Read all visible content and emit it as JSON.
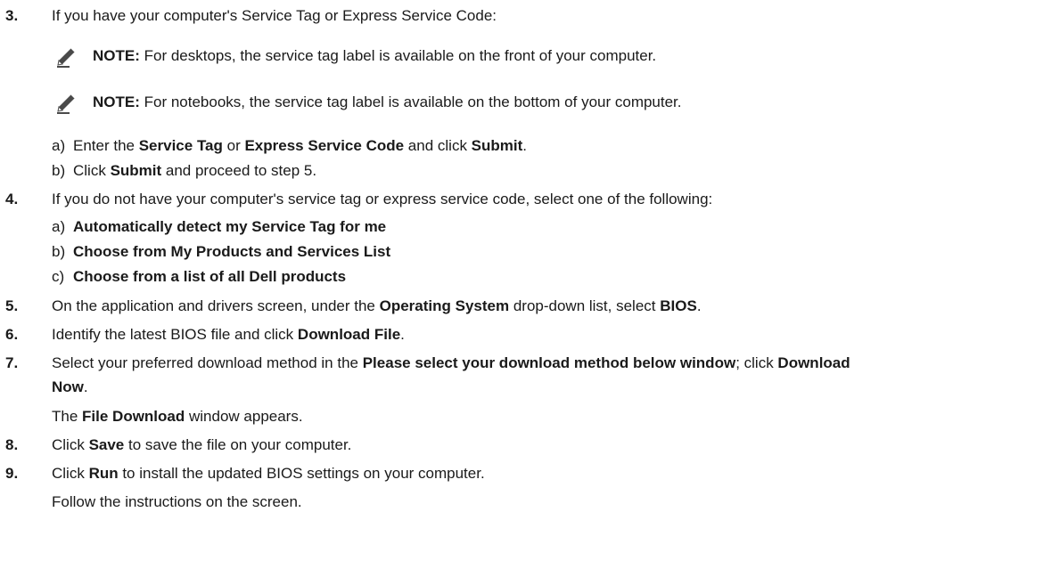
{
  "icons": {
    "note": "pencil-note-icon"
  },
  "steps": [
    {
      "number": "3.",
      "text": "If you have your computer's Service Tag or Express Service Code:",
      "notes": [
        {
          "label": "NOTE:",
          "text": " For desktops, the service tag label is available on the front of your computer."
        },
        {
          "label": "NOTE:",
          "text": " For notebooks, the service tag label is available on the bottom of your computer."
        }
      ],
      "substeps": [
        {
          "letter": "a)",
          "parts": [
            "Enter the ",
            "Service Tag",
            " or ",
            "Express Service Code",
            " and click ",
            "Submit",
            "."
          ]
        },
        {
          "letter": "b)",
          "parts": [
            "Click ",
            "Submit",
            " and proceed to step 5."
          ]
        }
      ]
    },
    {
      "number": "4.",
      "text": "If you do not have your computer's service tag or express service code, select one of the following:",
      "substeps": [
        {
          "letter": "a)",
          "text": "Automatically detect my Service Tag for me"
        },
        {
          "letter": "b)",
          "text": "Choose from My Products and Services List"
        },
        {
          "letter": "c)",
          "text": "Choose from a list of all Dell products"
        }
      ]
    },
    {
      "number": "5.",
      "parts": [
        "On the application and drivers screen, under the ",
        "Operating System",
        " drop-down list, select ",
        "BIOS",
        "."
      ]
    },
    {
      "number": "6.",
      "parts": [
        "Identify the latest BIOS file and click ",
        "Download File",
        "."
      ]
    },
    {
      "number": "7.",
      "parts_line1": [
        "Select your preferred download method in the ",
        "Please select your download method below window",
        "; click ",
        "Download"
      ],
      "parts_line2": [
        "Now",
        "."
      ],
      "result_parts": [
        "The ",
        "File Download",
        " window appears."
      ]
    },
    {
      "number": "8.",
      "parts": [
        "Click ",
        "Save",
        " to save the file on your computer."
      ]
    },
    {
      "number": "9.",
      "parts": [
        "Click ",
        "Run",
        " to install the updated BIOS settings on your computer."
      ],
      "result": "Follow the instructions on the screen."
    }
  ]
}
